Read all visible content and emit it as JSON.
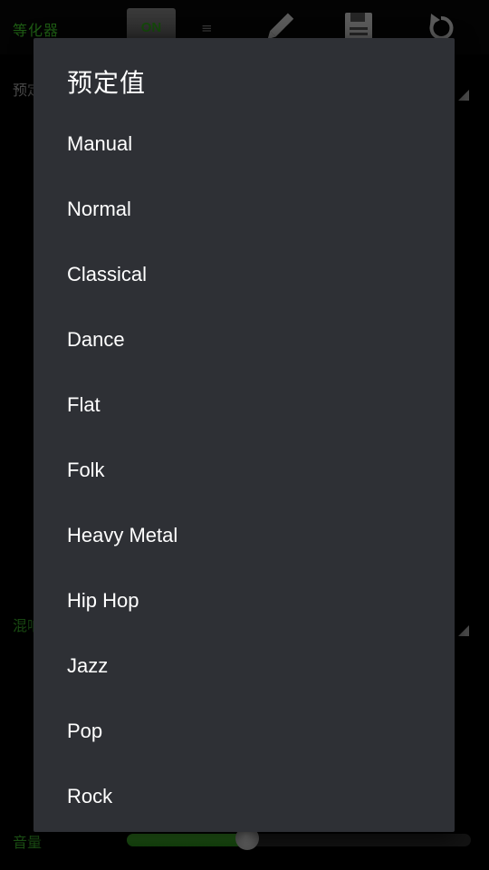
{
  "app": {
    "title": "等化器",
    "toggle_label": "ON",
    "toolbar_icons": [
      "pencil-icon",
      "save-icon",
      "reset-icon"
    ]
  },
  "background": {
    "preset_peek": "预定",
    "reverb_peek": "混响",
    "volume_label": "音量",
    "volume_level": 0.35
  },
  "dialog": {
    "title": "预定值",
    "options": [
      "Manual",
      "Normal",
      "Classical",
      "Dance",
      "Flat",
      "Folk",
      "Heavy Metal",
      "Hip Hop",
      "Jazz",
      "Pop",
      "Rock"
    ]
  },
  "colors": {
    "accent_green": "#2f8f1f",
    "dialog_bg": "#2e3035",
    "text": "#ffffff"
  }
}
